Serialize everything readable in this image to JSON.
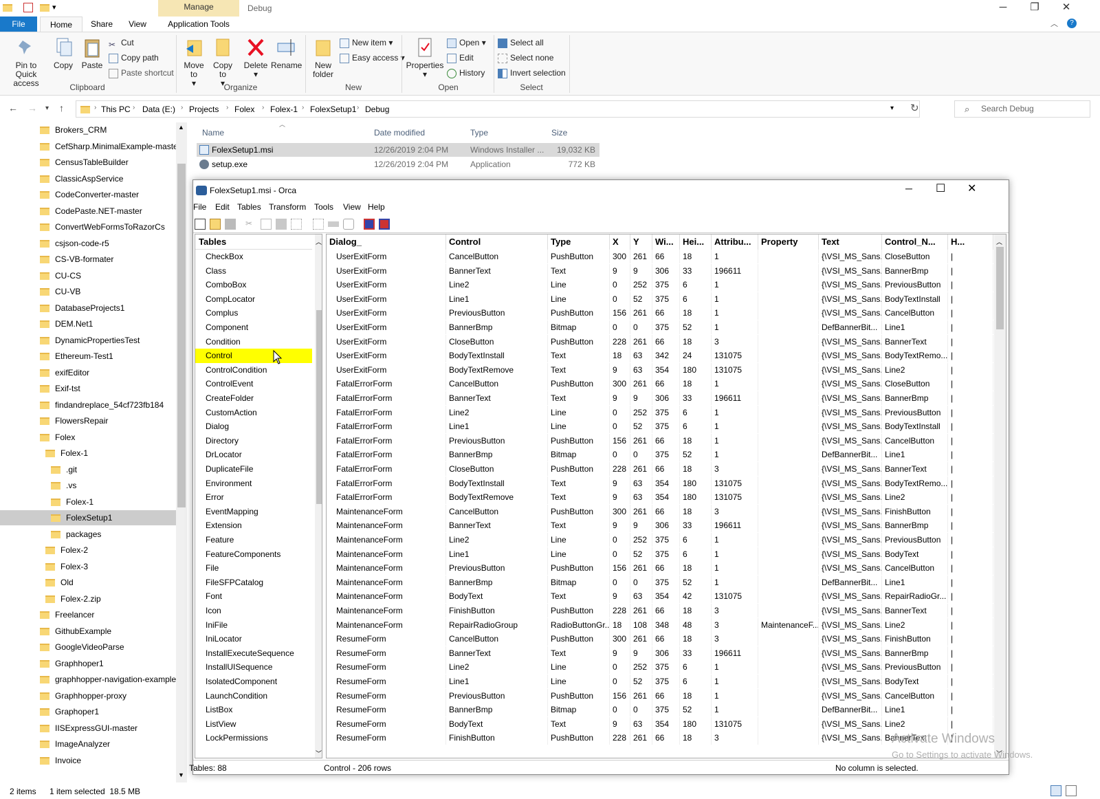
{
  "titlebar": {
    "manage": "Manage",
    "title": "Debug"
  },
  "ribbon_tabs": [
    "File",
    "Home",
    "Share",
    "View",
    "Application Tools"
  ],
  "clipboard": {
    "pin": "Pin to Quick access",
    "copy": "Copy",
    "paste": "Paste",
    "cut": "Cut",
    "copy_path": "Copy path",
    "paste_shortcut": "Paste shortcut",
    "label": "Clipboard"
  },
  "organize": {
    "move_to": "Move to",
    "copy_to": "Copy to",
    "delete": "Delete",
    "rename": "Rename",
    "label": "Organize"
  },
  "new_group": {
    "new_folder": "New folder",
    "new_item": "New item",
    "easy_access": "Easy access",
    "label": "New"
  },
  "open_group": {
    "properties": "Properties",
    "open": "Open",
    "edit": "Edit",
    "history": "History",
    "label": "Open"
  },
  "select_group": {
    "select_all": "Select all",
    "select_none": "Select none",
    "invert": "Invert selection",
    "label": "Select"
  },
  "address": {
    "crumbs": [
      "This PC",
      "Data (E:)",
      "Projects",
      "Folex",
      "Folex-1",
      "FolexSetup1",
      "Debug"
    ],
    "search_placeholder": "Search Debug"
  },
  "nav_items": [
    {
      "label": "Brokers_CRM",
      "indent": 0
    },
    {
      "label": "CefSharp.MinimalExample-maste",
      "indent": 0
    },
    {
      "label": "CensusTableBuilder",
      "indent": 0
    },
    {
      "label": "ClassicAspService",
      "indent": 0
    },
    {
      "label": "CodeConverter-master",
      "indent": 0
    },
    {
      "label": "CodePaste.NET-master",
      "indent": 0
    },
    {
      "label": "ConvertWebFormsToRazorCs",
      "indent": 0
    },
    {
      "label": "csjson-code-r5",
      "indent": 0
    },
    {
      "label": "CS-VB-formater",
      "indent": 0
    },
    {
      "label": "CU-CS",
      "indent": 0
    },
    {
      "label": "CU-VB",
      "indent": 0
    },
    {
      "label": "DatabaseProjects1",
      "indent": 0
    },
    {
      "label": "DEM.Net1",
      "indent": 0
    },
    {
      "label": "DynamicPropertiesTest",
      "indent": 0
    },
    {
      "label": "Ethereum-Test1",
      "indent": 0
    },
    {
      "label": "exifEditor",
      "indent": 0
    },
    {
      "label": "Exif-tst",
      "indent": 0
    },
    {
      "label": "findandreplace_54cf723fb184",
      "indent": 0
    },
    {
      "label": "FlowersRepair",
      "indent": 0
    },
    {
      "label": "Folex",
      "indent": 0
    },
    {
      "label": "Folex-1",
      "indent": 1
    },
    {
      "label": ".git",
      "indent": 2
    },
    {
      "label": ".vs",
      "indent": 2
    },
    {
      "label": "Folex-1",
      "indent": 2
    },
    {
      "label": "FolexSetup1",
      "indent": 2,
      "selected": true
    },
    {
      "label": "packages",
      "indent": 2
    },
    {
      "label": "Folex-2",
      "indent": 1
    },
    {
      "label": "Folex-3",
      "indent": 1
    },
    {
      "label": "Old",
      "indent": 1
    },
    {
      "label": "Folex-2.zip",
      "indent": 1
    },
    {
      "label": "Freelancer",
      "indent": 0
    },
    {
      "label": "GithubExample",
      "indent": 0
    },
    {
      "label": "GoogleVideoParse",
      "indent": 0
    },
    {
      "label": "Graphhoper1",
      "indent": 0
    },
    {
      "label": "graphhopper-navigation-example",
      "indent": 0
    },
    {
      "label": "Graphhopper-proxy",
      "indent": 0
    },
    {
      "label": "Graphoper1",
      "indent": 0
    },
    {
      "label": "IISExpressGUI-master",
      "indent": 0
    },
    {
      "label": "ImageAnalyzer",
      "indent": 0
    },
    {
      "label": "Invoice",
      "indent": 0
    }
  ],
  "files": {
    "headers": [
      "Name",
      "Date modified",
      "Type",
      "Size"
    ],
    "rows": [
      {
        "name": "FolexSetup1.msi",
        "date": "12/26/2019 2:04 PM",
        "type": "Windows Installer ...",
        "size": "19,032 KB"
      },
      {
        "name": "setup.exe",
        "date": "12/26/2019 2:04 PM",
        "type": "Application",
        "size": "772 KB"
      }
    ]
  },
  "orca": {
    "title": "FolexSetup1.msi - Orca",
    "menu": [
      "File",
      "Edit",
      "Tables",
      "Transform",
      "Tools",
      "View",
      "Help"
    ],
    "tables_header": "Tables",
    "tables": [
      "CheckBox",
      "Class",
      "ComboBox",
      "CompLocator",
      "Complus",
      "Component",
      "Condition",
      "Control",
      "ControlCondition",
      "ControlEvent",
      "CreateFolder",
      "CustomAction",
      "Dialog",
      "Directory",
      "DrLocator",
      "DuplicateFile",
      "Environment",
      "Error",
      "EventMapping",
      "Extension",
      "Feature",
      "FeatureComponents",
      "File",
      "FileSFPCatalog",
      "Font",
      "Icon",
      "IniFile",
      "IniLocator",
      "InstallExecuteSequence",
      "InstallUISequence",
      "IsolatedComponent",
      "LaunchCondition",
      "ListBox",
      "ListView",
      "LockPermissions"
    ],
    "selected_table": "Control",
    "columns": [
      "Dialog_",
      "Control",
      "Type",
      "X",
      "Y",
      "Wi...",
      "Hei...",
      "Attribu...",
      "Property",
      "Text",
      "Control_N...",
      "H..."
    ],
    "rows": [
      [
        "UserExitForm",
        "CancelButton",
        "PushButton",
        "300",
        "261",
        "66",
        "18",
        "1",
        "",
        "{\\VSI_MS_Sans...",
        "CloseButton",
        "|"
      ],
      [
        "UserExitForm",
        "BannerText",
        "Text",
        "9",
        "9",
        "306",
        "33",
        "196611",
        "",
        "{\\VSI_MS_Sans...",
        "BannerBmp",
        "|"
      ],
      [
        "UserExitForm",
        "Line2",
        "Line",
        "0",
        "252",
        "375",
        "6",
        "1",
        "",
        "{\\VSI_MS_Sans...",
        "PreviousButton",
        "|"
      ],
      [
        "UserExitForm",
        "Line1",
        "Line",
        "0",
        "52",
        "375",
        "6",
        "1",
        "",
        "{\\VSI_MS_Sans...",
        "BodyTextInstall",
        "|"
      ],
      [
        "UserExitForm",
        "PreviousButton",
        "PushButton",
        "156",
        "261",
        "66",
        "18",
        "1",
        "",
        "{\\VSI_MS_Sans...",
        "CancelButton",
        "|"
      ],
      [
        "UserExitForm",
        "BannerBmp",
        "Bitmap",
        "0",
        "0",
        "375",
        "52",
        "1",
        "",
        "DefBannerBit...",
        "Line1",
        "|"
      ],
      [
        "UserExitForm",
        "CloseButton",
        "PushButton",
        "228",
        "261",
        "66",
        "18",
        "3",
        "",
        "{\\VSI_MS_Sans...",
        "BannerText",
        "|"
      ],
      [
        "UserExitForm",
        "BodyTextInstall",
        "Text",
        "18",
        "63",
        "342",
        "24",
        "131075",
        "",
        "{\\VSI_MS_Sans...",
        "BodyTextRemo...",
        "|"
      ],
      [
        "UserExitForm",
        "BodyTextRemove",
        "Text",
        "9",
        "63",
        "354",
        "180",
        "131075",
        "",
        "{\\VSI_MS_Sans...",
        "Line2",
        "|"
      ],
      [
        "FatalErrorForm",
        "CancelButton",
        "PushButton",
        "300",
        "261",
        "66",
        "18",
        "1",
        "",
        "{\\VSI_MS_Sans...",
        "CloseButton",
        "|"
      ],
      [
        "FatalErrorForm",
        "BannerText",
        "Text",
        "9",
        "9",
        "306",
        "33",
        "196611",
        "",
        "{\\VSI_MS_Sans...",
        "BannerBmp",
        "|"
      ],
      [
        "FatalErrorForm",
        "Line2",
        "Line",
        "0",
        "252",
        "375",
        "6",
        "1",
        "",
        "{\\VSI_MS_Sans...",
        "PreviousButton",
        "|"
      ],
      [
        "FatalErrorForm",
        "Line1",
        "Line",
        "0",
        "52",
        "375",
        "6",
        "1",
        "",
        "{\\VSI_MS_Sans...",
        "BodyTextInstall",
        "|"
      ],
      [
        "FatalErrorForm",
        "PreviousButton",
        "PushButton",
        "156",
        "261",
        "66",
        "18",
        "1",
        "",
        "{\\VSI_MS_Sans...",
        "CancelButton",
        "|"
      ],
      [
        "FatalErrorForm",
        "BannerBmp",
        "Bitmap",
        "0",
        "0",
        "375",
        "52",
        "1",
        "",
        "DefBannerBit...",
        "Line1",
        "|"
      ],
      [
        "FatalErrorForm",
        "CloseButton",
        "PushButton",
        "228",
        "261",
        "66",
        "18",
        "3",
        "",
        "{\\VSI_MS_Sans...",
        "BannerText",
        "|"
      ],
      [
        "FatalErrorForm",
        "BodyTextInstall",
        "Text",
        "9",
        "63",
        "354",
        "180",
        "131075",
        "",
        "{\\VSI_MS_Sans...",
        "BodyTextRemo...",
        "|"
      ],
      [
        "FatalErrorForm",
        "BodyTextRemove",
        "Text",
        "9",
        "63",
        "354",
        "180",
        "131075",
        "",
        "{\\VSI_MS_Sans...",
        "Line2",
        "|"
      ],
      [
        "MaintenanceForm",
        "CancelButton",
        "PushButton",
        "300",
        "261",
        "66",
        "18",
        "3",
        "",
        "{\\VSI_MS_Sans...",
        "FinishButton",
        "|"
      ],
      [
        "MaintenanceForm",
        "BannerText",
        "Text",
        "9",
        "9",
        "306",
        "33",
        "196611",
        "",
        "{\\VSI_MS_Sans...",
        "BannerBmp",
        "|"
      ],
      [
        "MaintenanceForm",
        "Line2",
        "Line",
        "0",
        "252",
        "375",
        "6",
        "1",
        "",
        "{\\VSI_MS_Sans...",
        "PreviousButton",
        "|"
      ],
      [
        "MaintenanceForm",
        "Line1",
        "Line",
        "0",
        "52",
        "375",
        "6",
        "1",
        "",
        "{\\VSI_MS_Sans...",
        "BodyText",
        "|"
      ],
      [
        "MaintenanceForm",
        "PreviousButton",
        "PushButton",
        "156",
        "261",
        "66",
        "18",
        "1",
        "",
        "{\\VSI_MS_Sans...",
        "CancelButton",
        "|"
      ],
      [
        "MaintenanceForm",
        "BannerBmp",
        "Bitmap",
        "0",
        "0",
        "375",
        "52",
        "1",
        "",
        "DefBannerBit...",
        "Line1",
        "|"
      ],
      [
        "MaintenanceForm",
        "BodyText",
        "Text",
        "9",
        "63",
        "354",
        "42",
        "131075",
        "",
        "{\\VSI_MS_Sans...",
        "RepairRadioGr...",
        "|"
      ],
      [
        "MaintenanceForm",
        "FinishButton",
        "PushButton",
        "228",
        "261",
        "66",
        "18",
        "3",
        "",
        "{\\VSI_MS_Sans...",
        "BannerText",
        "|"
      ],
      [
        "MaintenanceForm",
        "RepairRadioGroup",
        "RadioButtonGr...",
        "18",
        "108",
        "348",
        "48",
        "3",
        "MaintenanceF...",
        "{\\VSI_MS_Sans...",
        "Line2",
        "|"
      ],
      [
        "ResumeForm",
        "CancelButton",
        "PushButton",
        "300",
        "261",
        "66",
        "18",
        "3",
        "",
        "{\\VSI_MS_Sans...",
        "FinishButton",
        "|"
      ],
      [
        "ResumeForm",
        "BannerText",
        "Text",
        "9",
        "9",
        "306",
        "33",
        "196611",
        "",
        "{\\VSI_MS_Sans...",
        "BannerBmp",
        "|"
      ],
      [
        "ResumeForm",
        "Line2",
        "Line",
        "0",
        "252",
        "375",
        "6",
        "1",
        "",
        "{\\VSI_MS_Sans...",
        "PreviousButton",
        "|"
      ],
      [
        "ResumeForm",
        "Line1",
        "Line",
        "0",
        "52",
        "375",
        "6",
        "1",
        "",
        "{\\VSI_MS_Sans...",
        "BodyText",
        "|"
      ],
      [
        "ResumeForm",
        "PreviousButton",
        "PushButton",
        "156",
        "261",
        "66",
        "18",
        "1",
        "",
        "{\\VSI_MS_Sans...",
        "CancelButton",
        "|"
      ],
      [
        "ResumeForm",
        "BannerBmp",
        "Bitmap",
        "0",
        "0",
        "375",
        "52",
        "1",
        "",
        "DefBannerBit...",
        "Line1",
        "|"
      ],
      [
        "ResumeForm",
        "BodyText",
        "Text",
        "9",
        "63",
        "354",
        "180",
        "131075",
        "",
        "{\\VSI_MS_Sans...",
        "Line2",
        "|"
      ],
      [
        "ResumeForm",
        "FinishButton",
        "PushButton",
        "228",
        "261",
        "66",
        "18",
        "3",
        "",
        "{\\VSI_MS_Sans...",
        "BannerText",
        "|"
      ]
    ],
    "status": {
      "tables": "Tables: 88",
      "rows": "Control - 206 rows",
      "column": "No column is selected."
    }
  },
  "statusbar": {
    "items": "2 items",
    "selected": "1 item selected  18.5 MB"
  },
  "watermark": {
    "line1": "Activate Windows",
    "line2": "Go to Settings to activate Windows."
  },
  "colors": {
    "accent": "#0063b1",
    "selected_table": "#ffff00",
    "manage_tab": "#f6e6b4"
  }
}
